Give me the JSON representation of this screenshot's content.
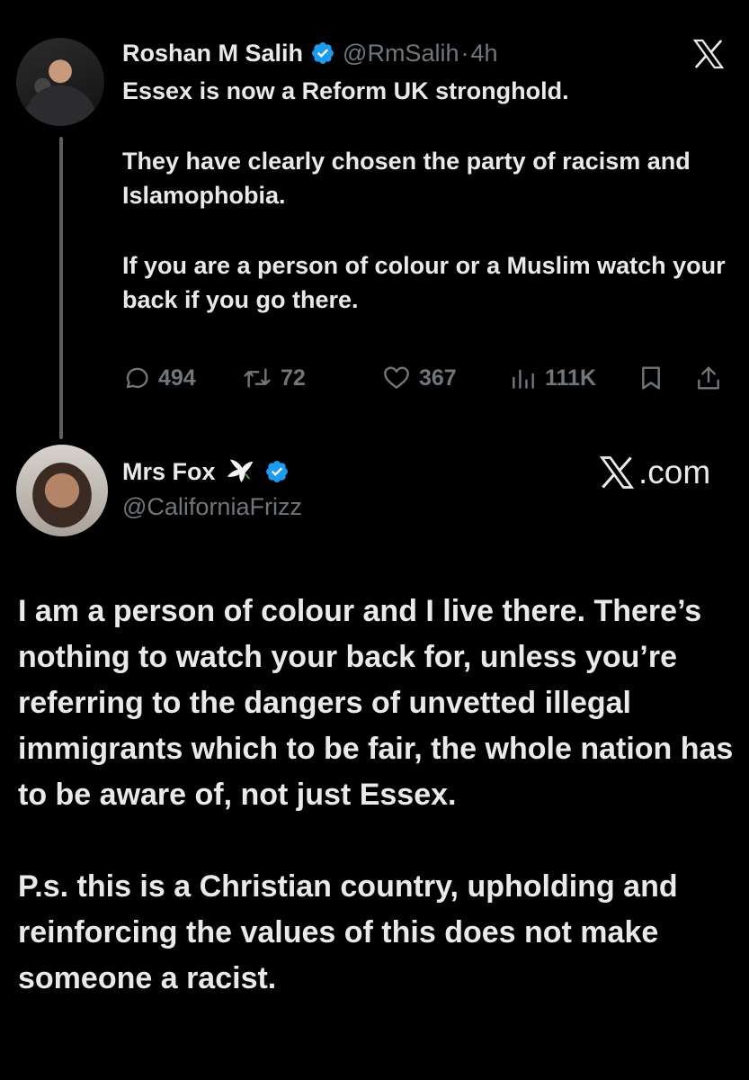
{
  "tweet": {
    "author_name": "Roshan M Salih",
    "author_handle": "@RmSalih",
    "separator": "·",
    "time": "4h",
    "paragraphs": [
      "Essex is now a Reform UK stronghold.",
      "They have clearly chosen the party of racism and Islamophobia.",
      "If you are a person of colour or a Muslim watch your back if you go there."
    ],
    "stats": {
      "replies": "494",
      "reposts": "72",
      "likes": "367",
      "views": "111K"
    }
  },
  "reply": {
    "author_name": "Mrs Fox",
    "author_handle": "@CaliforniaFrizz",
    "source": ".com",
    "paragraphs": [
      "I am a person of colour and I live there. There’s nothing to watch your back for, unless you’re referring to the dangers of unvetted illegal immigrants which to be fair, the whole nation has to be aware of, not just Essex.",
      "P.s. this is a Christian country, upholding and reinforcing the values of this does not make someone a racist."
    ]
  },
  "icons": {
    "verified_color": "#1d9bf0",
    "stat_color": "#71767b",
    "text_color": "#e7e9ea",
    "background": "#000000"
  }
}
